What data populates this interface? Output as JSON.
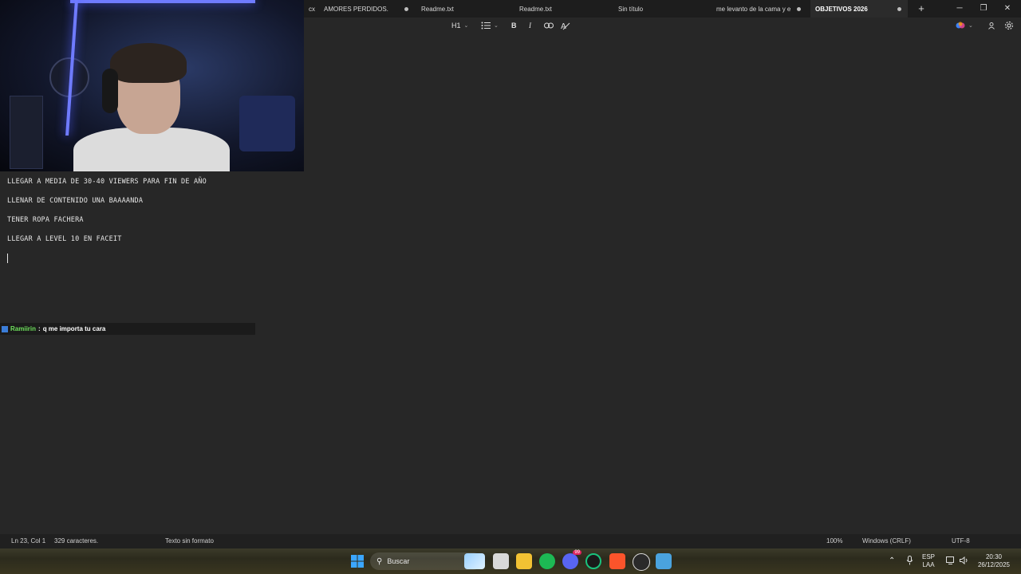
{
  "tabs": [
    {
      "label": "cx",
      "dirty": false
    },
    {
      "label": "AMORES PERDIDOS.",
      "dirty": true
    },
    {
      "label": "Readme.txt",
      "dirty": false
    },
    {
      "label": "Readme.txt",
      "dirty": false
    },
    {
      "label": "Sin título",
      "dirty": false
    },
    {
      "label": "me levanto de la cama y e",
      "dirty": true
    },
    {
      "label": "OBJETIVOS 2026",
      "dirty": true,
      "active": true
    }
  ],
  "new_tab_label": "+",
  "window_controls": {
    "minimize": "─",
    "restore": "❐",
    "close": "✕"
  },
  "toolbar": {
    "heading": "H1",
    "list_icon": "list-icon",
    "bold": "B",
    "italic": "I",
    "link_icon": "link-icon",
    "clear_format_icon": "clear-format-icon",
    "copilot_icon": "copilot-icon",
    "account_icon": "account-icon",
    "settings_icon": "gear-icon"
  },
  "document": {
    "lines": [
      "LLEGAR A MEDIA DE 30-40 VIEWERS PARA FIN DE AÑO",
      "LLENAR DE CONTENIDO UNA BAAAANDA",
      "TENER ROPA FACHERA",
      "LLEGAR A LEVEL 10 EN FACEIT"
    ]
  },
  "chat": {
    "user": "Ramiirin",
    "separator": ":",
    "message": "q me importa tu cara"
  },
  "status_bar": {
    "position": "Ln 23, Col 1",
    "chars": "329 caracteres.",
    "format": "Texto sin formato",
    "zoom": "100%",
    "line_ending": "Windows (CRLF)",
    "encoding": "UTF-8"
  },
  "taskbar": {
    "search_placeholder": "Buscar",
    "apps": [
      "start-icon",
      "search-icon",
      "widget-icon",
      "task-view-icon",
      "file-explorer-icon",
      "spotify-icon",
      "discord-icon",
      "app-icon",
      "brave-icon",
      "obs-icon",
      "notepad-icon"
    ],
    "discord_badge": "99",
    "language": "ESP",
    "language_sub": "LAA",
    "time": "20:30",
    "date": "26/12/2025"
  },
  "colors": {
    "accent": "#6f7bff",
    "chat_user": "#6ee05c",
    "background": "#272727"
  }
}
